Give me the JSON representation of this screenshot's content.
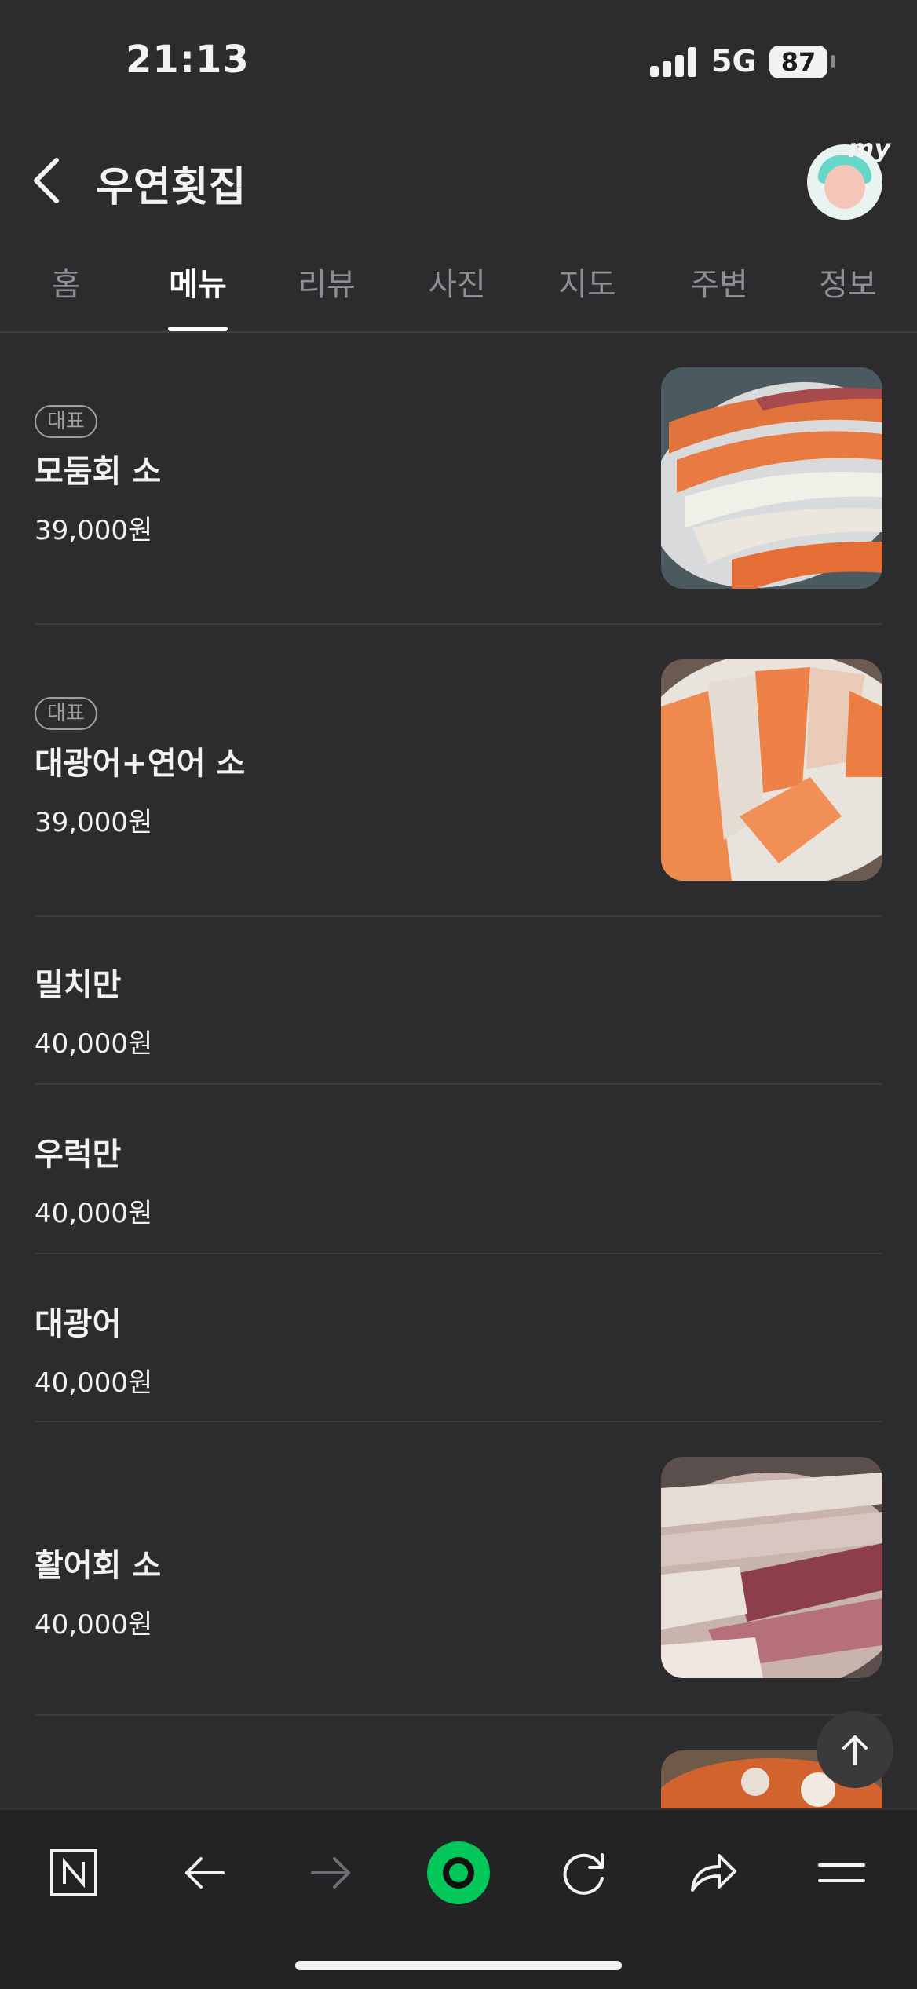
{
  "status_bar": {
    "time": "21:13",
    "network": "5G",
    "battery": "87"
  },
  "header": {
    "title": "우연횟집",
    "avatar_label": "my"
  },
  "tabs": [
    {
      "label": "홈",
      "active": false
    },
    {
      "label": "메뉴",
      "active": true
    },
    {
      "label": "리뷰",
      "active": false
    },
    {
      "label": "사진",
      "active": false
    },
    {
      "label": "지도",
      "active": false
    },
    {
      "label": "주변",
      "active": false
    },
    {
      "label": "정보",
      "active": false
    }
  ],
  "menu": {
    "items": [
      {
        "badge": "대표",
        "name": "모둠회 소",
        "price": "39,000원",
        "image": "salmon-and-white-fish-sashimi-platter"
      },
      {
        "badge": "대표",
        "name": "대광어+연어 소",
        "price": "39,000원",
        "image": "flounder-and-salmon-sashimi-platter"
      },
      {
        "name": "밀치만",
        "price": "40,000원"
      },
      {
        "name": "우럭만",
        "price": "40,000원"
      },
      {
        "name": "대광어",
        "price": "40,000원"
      },
      {
        "name": "활어회 소",
        "price": "40,000원",
        "image": "mixed-raw-fish-platter"
      }
    ]
  },
  "colors": {
    "background": "#2c2c2e",
    "accent": "#03c75a",
    "text": "#f2f2f2",
    "muted": "#8e8e93"
  },
  "bottom_bar": {
    "icons": [
      "naver-icon",
      "back-arrow-icon",
      "forward-arrow-icon",
      "green-dot-icon",
      "refresh-icon",
      "share-icon",
      "menu-icon"
    ]
  }
}
